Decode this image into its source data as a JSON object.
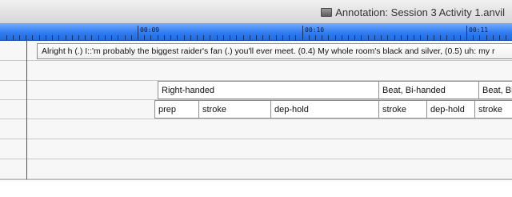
{
  "window": {
    "title": "Annotation: Session 3 Activity 1.anvil"
  },
  "ruler": {
    "time_labels": [
      "00:09",
      "00:10",
      "00:11"
    ]
  },
  "tracks": {
    "transcript": {
      "text": "Alright h (.) I::'m probably the biggest raider's fan (.) you'll ever meet. (0.4) My whole room's black and silver, (0.5) uh: my r"
    },
    "handedness": [
      "Right-handed",
      "Beat, Bi-handed",
      "Beat, Bi-"
    ],
    "phases": [
      "prep",
      "stroke",
      "dep-hold",
      "stroke",
      "dep-hold",
      "stroke"
    ]
  },
  "colors": {
    "ruler_top": "#6ea7ff",
    "ruler_bottom": "#1f6be2",
    "playhead": "#c8201e",
    "track_bg": "#f7f7f7"
  }
}
